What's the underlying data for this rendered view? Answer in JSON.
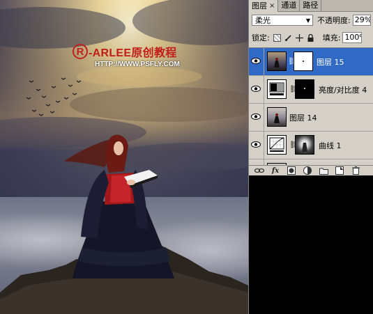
{
  "canvas": {
    "logo_mark": "R",
    "logo_text": "-ARLEE原创教程",
    "logo_url": "HTTP://WWW.PSFLY.COM"
  },
  "panel": {
    "tabs": [
      {
        "label": "图层",
        "active": true,
        "closable": true
      },
      {
        "label": "通道",
        "active": false
      },
      {
        "label": "路径",
        "active": false
      }
    ],
    "close_glyph": "×",
    "blend_mode": "柔光",
    "opacity_label": "不透明度:",
    "opacity_value": "29%",
    "lock_label": "锁定:",
    "fill_label": "填充:",
    "fill_value": "100%",
    "layers": [
      {
        "name": "图层 15",
        "selected": true,
        "visible": true,
        "thumb": "photo",
        "mask": "white-dot"
      },
      {
        "name": "亮度/对比度 4",
        "selected": false,
        "visible": true,
        "thumb": "brightness-contrast-icon",
        "mask": "black-dot"
      },
      {
        "name": "图层 14",
        "selected": false,
        "visible": true,
        "thumb": "photo"
      },
      {
        "name": "曲线 1",
        "selected": false,
        "visible": true,
        "thumb": "curves-icon",
        "mask": "dark-figure"
      }
    ],
    "bottom_icons": [
      "link-icon",
      "fx-icon",
      "mask-icon",
      "adjustment-icon",
      "folder-icon",
      "new-layer-icon",
      "trash-icon"
    ],
    "fx_label": "fx"
  }
}
